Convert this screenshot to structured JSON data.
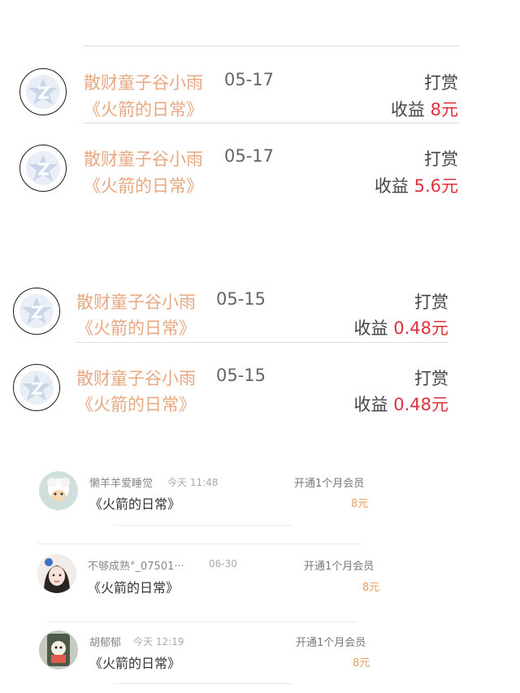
{
  "rewards": [
    {
      "name": "散财童子谷小雨",
      "date": "05-17",
      "book": "《火箭的日常》",
      "type": "打赏",
      "income_label": "收益",
      "amount": "8元"
    },
    {
      "name": "散财童子谷小雨",
      "date": "05-17",
      "book": "《火箭的日常》",
      "type": "打赏",
      "income_label": "收益",
      "amount": "5.6元"
    },
    {
      "name": "散财童子谷小雨",
      "date": "05-15",
      "book": "《火箭的日常》",
      "type": "打赏",
      "income_label": "收益",
      "amount": "0.48元"
    },
    {
      "name": "散财童子谷小雨",
      "date": "05-15",
      "book": "《火箭的日常》",
      "type": "打赏",
      "income_label": "收益",
      "amount": "0.48元"
    }
  ],
  "members": [
    {
      "name": "懒羊羊爱睡觉",
      "time": "今天 11:48",
      "book": "《火箭的日常》",
      "type": "开通1个月会员",
      "amount": "8元"
    },
    {
      "name": "不够成熟°_07501···",
      "time": "06-30",
      "book": "《火箭的日常》",
      "type": "开通1个月会员",
      "amount": "8元"
    },
    {
      "name": "胡郁郁",
      "time": "今天 12:19",
      "book": "《火箭的日常》",
      "type": "开通1个月会员",
      "amount": "8元"
    }
  ],
  "colors": {
    "accent": "#e8a882",
    "amount": "#e0303c",
    "avatar_icon": "#c9d6ea"
  },
  "icons": {
    "reward_avatar": "qzone-star-icon"
  }
}
